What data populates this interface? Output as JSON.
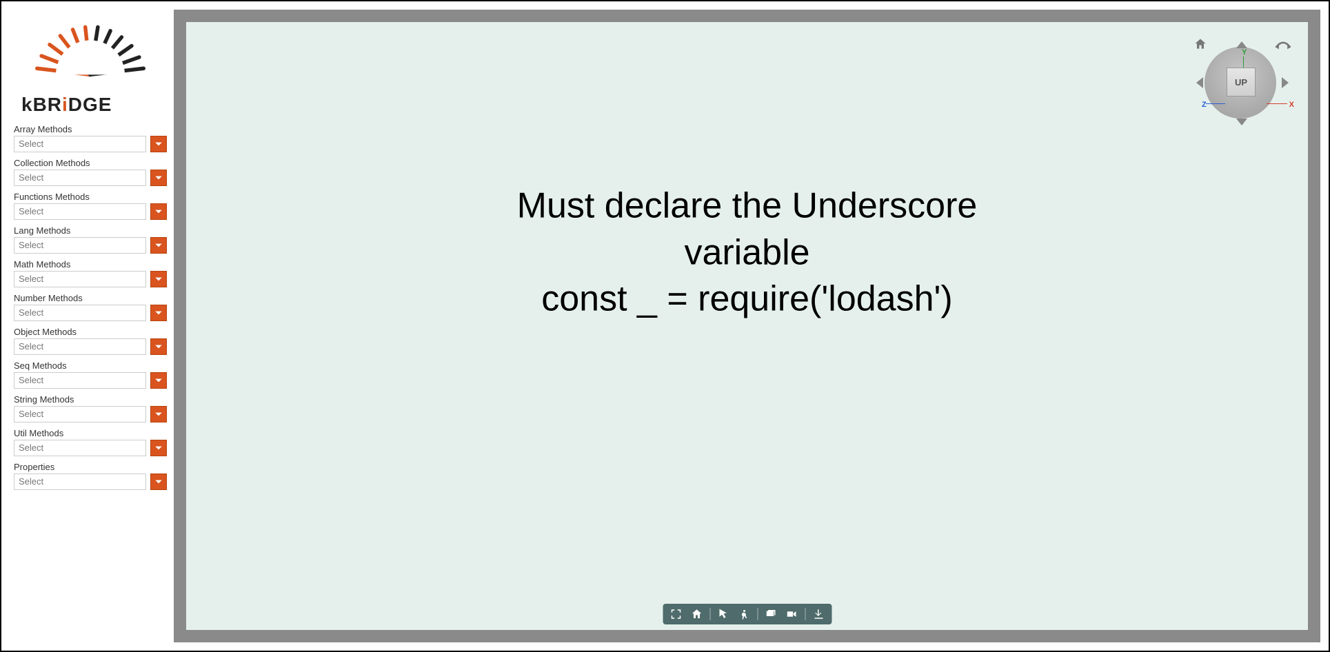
{
  "brand": {
    "name": "kBRiDGE"
  },
  "sidebar": {
    "select_placeholder": "Select",
    "groups": [
      {
        "label": "Array Methods"
      },
      {
        "label": "Collection Methods"
      },
      {
        "label": "Functions Methods"
      },
      {
        "label": "Lang Methods"
      },
      {
        "label": "Math Methods"
      },
      {
        "label": "Number Methods"
      },
      {
        "label": "Object Methods"
      },
      {
        "label": "Seq Methods"
      },
      {
        "label": "String Methods"
      },
      {
        "label": "Util Methods"
      },
      {
        "label": "Properties"
      }
    ]
  },
  "viewport": {
    "message_line1": "Must declare the Underscore variable",
    "message_line2": "const _ = require('lodash')"
  },
  "viewcube": {
    "face_label": "UP",
    "axes": {
      "x": "X",
      "y": "Y",
      "z": "Z"
    }
  },
  "toolbar": {
    "items": [
      {
        "name": "fullscreen"
      },
      {
        "name": "home"
      },
      {
        "name": "separator"
      },
      {
        "name": "pointer"
      },
      {
        "name": "walk"
      },
      {
        "name": "separator"
      },
      {
        "name": "layers"
      },
      {
        "name": "camera"
      },
      {
        "name": "separator"
      },
      {
        "name": "download"
      }
    ]
  }
}
